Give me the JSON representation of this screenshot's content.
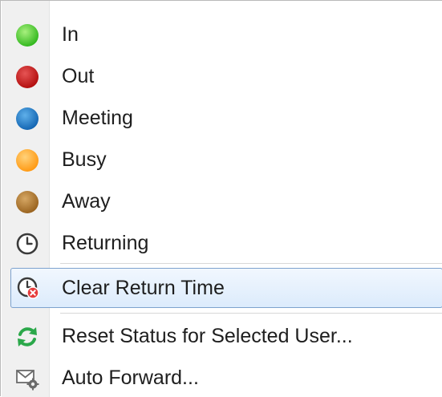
{
  "menu": {
    "items": [
      {
        "label": "In",
        "icon": "green-dot-icon",
        "color": "#33cc33"
      },
      {
        "label": "Out",
        "icon": "red-dot-icon",
        "color": "#cc1f1f"
      },
      {
        "label": "Meeting",
        "icon": "blue-dot-icon",
        "color": "#1f7fcc"
      },
      {
        "label": "Busy",
        "icon": "orange-dot-icon",
        "color": "#ffa31a"
      },
      {
        "label": "Away",
        "icon": "brown-dot-icon",
        "color": "#b37a29"
      },
      {
        "label": "Returning",
        "icon": "clock-icon"
      },
      {
        "label": "Clear Return Time",
        "icon": "clock-clear-icon",
        "highlighted": true
      },
      {
        "label": "Reset Status for Selected User...",
        "icon": "reset-arrows-icon"
      },
      {
        "label": "Auto Forward...",
        "icon": "envelope-gear-icon"
      }
    ]
  }
}
